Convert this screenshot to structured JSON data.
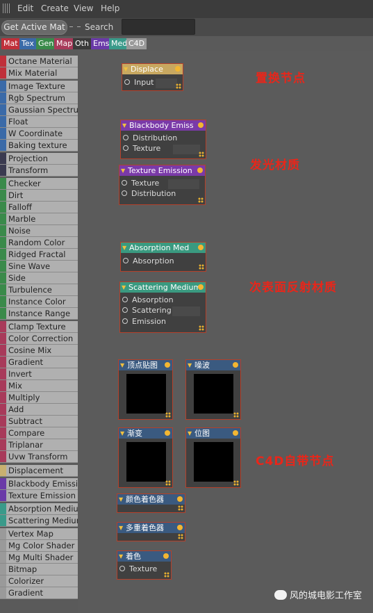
{
  "menubar": {
    "items": [
      "Edit",
      "Create",
      "View",
      "Help"
    ]
  },
  "toolbar": {
    "get_active_mat": "Get Active Mat",
    "search_label": "Search",
    "search_value": ""
  },
  "tabs": [
    {
      "label": "Mat",
      "color": "#c0303a"
    },
    {
      "label": "Tex",
      "color": "#3a6aa8"
    },
    {
      "label": "Gen",
      "color": "#3a8a4a"
    },
    {
      "label": "Map",
      "color": "#a83a5a"
    },
    {
      "label": "Oth",
      "color": "#3a3a3a"
    },
    {
      "label": "Ems",
      "color": "#6a3aa8"
    },
    {
      "label": "Med",
      "color": "#3a9a8a"
    },
    {
      "label": "C4D",
      "color": "#9a9a9a"
    }
  ],
  "sidebar": {
    "items": [
      {
        "label": "Octane Material",
        "color": "#c0303a"
      },
      {
        "label": "Mix Material",
        "color": "#c0303a"
      },
      {
        "label": "Image Texture",
        "color": "#3a6aa8"
      },
      {
        "label": "Rgb Spectrum",
        "color": "#3a6aa8"
      },
      {
        "label": "Gaussian Spectrum",
        "color": "#3a6aa8"
      },
      {
        "label": "Float",
        "color": "#3a6aa8"
      },
      {
        "label": "W Coordinate",
        "color": "#3a6aa8"
      },
      {
        "label": "Baking texture",
        "color": "#3a6aa8"
      },
      {
        "label": "Projection",
        "color": "#3a3a50"
      },
      {
        "label": "Transform",
        "color": "#3a3a50"
      },
      {
        "label": "Checker",
        "color": "#3a8a4a"
      },
      {
        "label": "Dirt",
        "color": "#3a8a4a"
      },
      {
        "label": "Falloff",
        "color": "#3a8a4a"
      },
      {
        "label": "Marble",
        "color": "#3a8a4a"
      },
      {
        "label": "Noise",
        "color": "#3a8a4a"
      },
      {
        "label": "Random Color",
        "color": "#3a8a4a"
      },
      {
        "label": "Ridged Fractal",
        "color": "#3a8a4a"
      },
      {
        "label": "Sine Wave",
        "color": "#3a8a4a"
      },
      {
        "label": "Side",
        "color": "#3a8a4a"
      },
      {
        "label": "Turbulence",
        "color": "#3a8a4a"
      },
      {
        "label": "Instance Color",
        "color": "#3a8a4a"
      },
      {
        "label": "Instance Range",
        "color": "#3a8a4a"
      },
      {
        "label": "Clamp Texture",
        "color": "#a83a5a"
      },
      {
        "label": "Color Correction",
        "color": "#a83a5a"
      },
      {
        "label": "Cosine Mix",
        "color": "#a83a5a"
      },
      {
        "label": "Gradient",
        "color": "#a83a5a"
      },
      {
        "label": "Invert",
        "color": "#a83a5a"
      },
      {
        "label": "Mix",
        "color": "#a83a5a"
      },
      {
        "label": "Multiply",
        "color": "#a83a5a"
      },
      {
        "label": "Add",
        "color": "#a83a5a"
      },
      {
        "label": "Subtract",
        "color": "#a83a5a"
      },
      {
        "label": "Compare",
        "color": "#a83a5a"
      },
      {
        "label": "Triplanar",
        "color": "#a83a5a"
      },
      {
        "label": "Uvw Transform",
        "color": "#a83a5a"
      },
      {
        "label": "Displacement",
        "color": "#c8b070"
      },
      {
        "label": "Blackbody Emission",
        "color": "#6a3aa8"
      },
      {
        "label": "Texture Emission",
        "color": "#6a3aa8"
      },
      {
        "label": "Absorption Medium",
        "color": "#3a9a8a"
      },
      {
        "label": "Scattering Medium",
        "color": "#3a9a8a"
      },
      {
        "label": "Vertex Map",
        "color": "#9a9a9a"
      },
      {
        "label": "Mg Color Shader",
        "color": "#9a9a9a"
      },
      {
        "label": "Mg Multi Shader",
        "color": "#9a9a9a"
      },
      {
        "label": "Bitmap",
        "color": "#9a9a9a"
      },
      {
        "label": "Colorizer",
        "color": "#9a9a9a"
      },
      {
        "label": "Gradient",
        "color": "#9a9a9a"
      }
    ]
  },
  "nodes": {
    "displace": {
      "title": "Displace",
      "color": "#c8a860",
      "ports": [
        "Input"
      ]
    },
    "blackbody": {
      "title": "Blackbody Emiss",
      "color": "#7a3aa8",
      "ports": [
        "Distribution",
        "Texture"
      ]
    },
    "texemission": {
      "title": "Texture Emission",
      "color": "#7a3aa8",
      "ports": [
        "Texture",
        "Distribution"
      ]
    },
    "absorption": {
      "title": "Absorption Med",
      "color": "#3a9a80",
      "ports": [
        "Absorption"
      ]
    },
    "scattering": {
      "title": "Scattering Medium",
      "color": "#3a9a80",
      "ports": [
        "Absorption",
        "Scattering",
        "Emission"
      ]
    },
    "vertexmap": {
      "title": "顶点贴图",
      "color": "#3a5a80"
    },
    "noise": {
      "title": "噪波",
      "color": "#3a5a80"
    },
    "gradient": {
      "title": "渐变",
      "color": "#3a5a80"
    },
    "bitmap": {
      "title": "位图",
      "color": "#3a5a80"
    },
    "colorshader": {
      "title": "颜色着色器",
      "color": "#3a5a80"
    },
    "multishader": {
      "title": "多重着色器",
      "color": "#3a5a80"
    },
    "colorizer": {
      "title": "着色",
      "color": "#3a5a80",
      "ports": [
        "Texture"
      ]
    }
  },
  "annotations": {
    "displace": "置换节点",
    "emission": "发光材质",
    "subsurface": "次表面反射材质",
    "c4d": "C4D自带节点"
  },
  "watermark": "风的城电影工作室"
}
